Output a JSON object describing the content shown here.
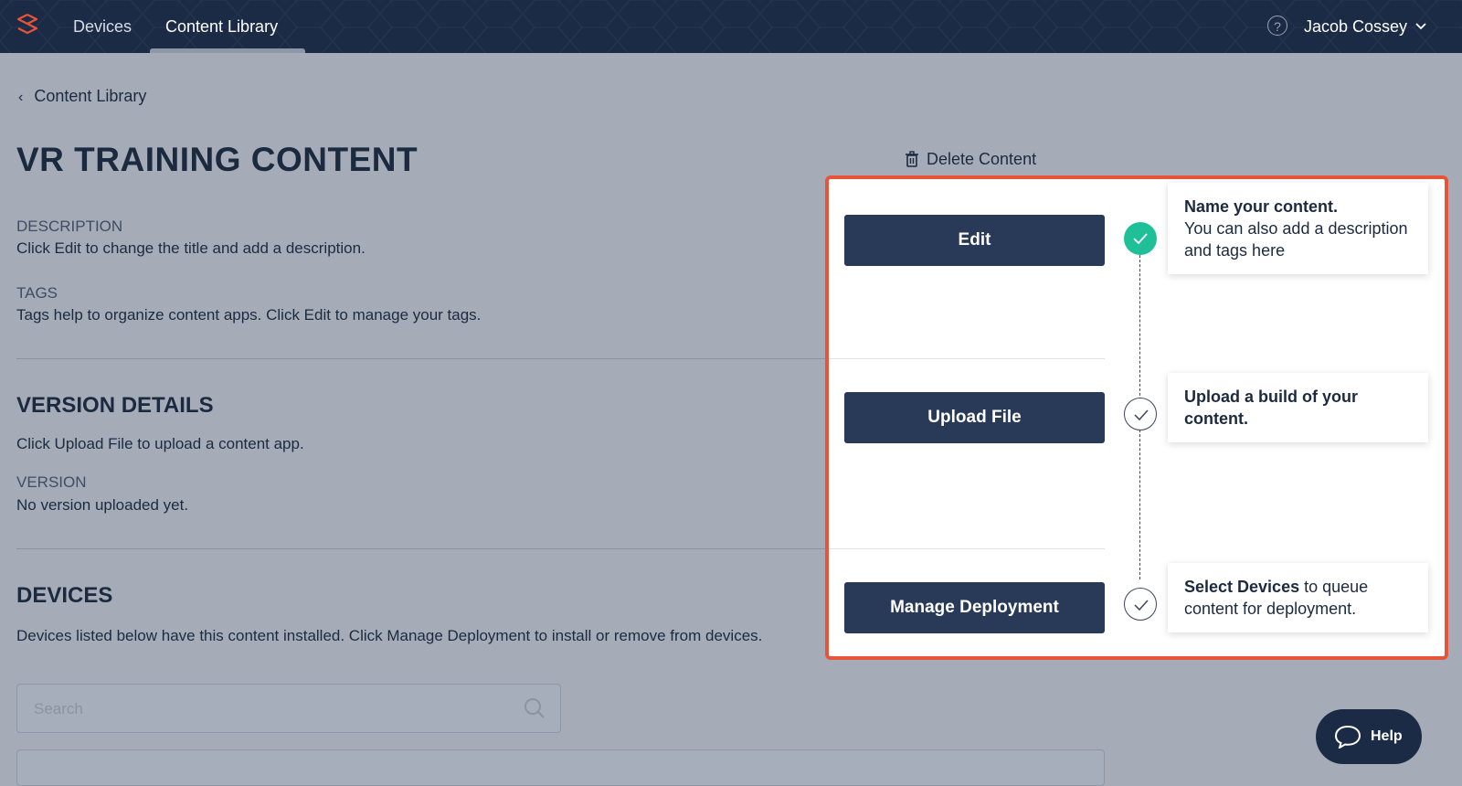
{
  "nav": {
    "tabs": [
      {
        "label": "Devices"
      },
      {
        "label": "Content Library"
      }
    ],
    "help_glyph": "?",
    "user_name": "Jacob Cossey"
  },
  "breadcrumb": {
    "back_label": "Content Library"
  },
  "page": {
    "title": "VR TRAINING CONTENT",
    "delete_label": "Delete Content"
  },
  "description": {
    "label": "DESCRIPTION",
    "text": "Click Edit to change the title and add a description."
  },
  "tags": {
    "label": "TAGS",
    "text": "Tags help to organize content apps. Click Edit to manage your tags."
  },
  "version_details": {
    "heading": "VERSION DETAILS",
    "text": "Click Upload File to upload a content app.",
    "version_label": "VERSION",
    "version_text": "No version uploaded yet."
  },
  "devices": {
    "heading": "DEVICES",
    "text": "Devices listed below have this content installed. Click Manage Deployment to install or remove from devices.",
    "search_placeholder": "Search"
  },
  "guide": {
    "steps": [
      {
        "button": "Edit",
        "status": "done",
        "card_bold": "Name your content.",
        "card_text": "You can also add a description and tags here"
      },
      {
        "button": "Upload File",
        "status": "pending",
        "card_bold": "Upload a build of your content.",
        "card_text": ""
      },
      {
        "button": "Manage Deployment",
        "status": "pending",
        "card_bold": "Select Devices",
        "card_text": " to queue content for deployment."
      }
    ]
  },
  "help_widget": {
    "label": "Help"
  },
  "colors": {
    "nav_bg": "#1c2b45",
    "overlay_border": "#e8543a",
    "done_step": "#1fbf98",
    "primary_button": "#283a57"
  }
}
